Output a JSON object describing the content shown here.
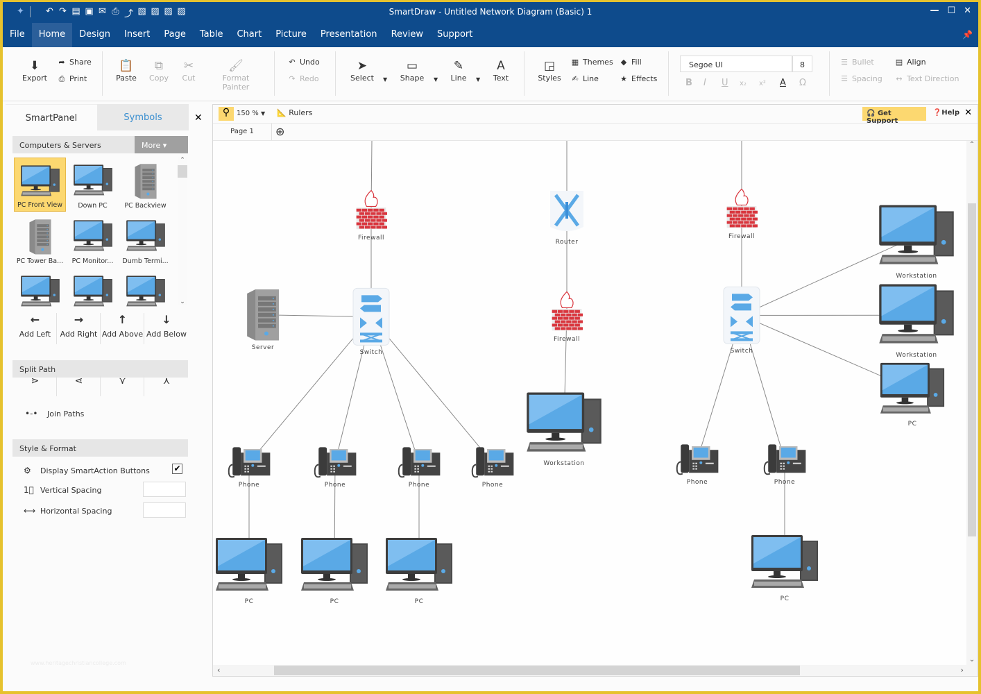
{
  "window": {
    "title": "SmartDraw - Untitled Network Diagram (Basic) 1",
    "controls": [
      "minimize-icon",
      "maximize-icon",
      "close-icon"
    ]
  },
  "quick_access": [
    "undo-icon",
    "redo-icon",
    "new-doc-icon",
    "save-icon",
    "email-icon",
    "print-icon",
    "share-icon",
    "pdf-icon",
    "word-icon",
    "powerpoint-icon",
    "excel-icon"
  ],
  "menu": {
    "items": [
      "File",
      "Home",
      "Design",
      "Insert",
      "Page",
      "Table",
      "Chart",
      "Picture",
      "Presentation",
      "Review",
      "Support"
    ],
    "active": "Home"
  },
  "ribbon": {
    "export": "Export",
    "share": "Share",
    "print": "Print",
    "paste": "Paste",
    "copy": "Copy",
    "cut": "Cut",
    "format_painter": "Format Painter",
    "undo": "Undo",
    "redo": "Redo",
    "select": "Select",
    "shape": "Shape",
    "line": "Line",
    "text": "Text",
    "styles": "Styles",
    "themes": "Themes",
    "fill": "Fill",
    "line_style": "Line",
    "effects": "Effects",
    "font_name": "Segoe UI",
    "font_size": "8",
    "format_buttons": [
      "B",
      "I",
      "U",
      "x₂",
      "x²",
      "A",
      "Ω"
    ],
    "bullet": "Bullet",
    "spacing": "Spacing",
    "align": "Align",
    "text_direction": "Text Direction"
  },
  "sidepanel": {
    "tabs": [
      "SmartPanel",
      "Symbols"
    ],
    "active_tab": "Symbols",
    "library": "Computers & Servers",
    "more": "More",
    "symbols": [
      {
        "label": "PC Front View",
        "selected": true
      },
      {
        "label": "Down PC"
      },
      {
        "label": "PC Backview"
      },
      {
        "label": "PC Tower Ba..."
      },
      {
        "label": "PC Monitor..."
      },
      {
        "label": "Dumb Termi..."
      },
      {
        "label": ""
      },
      {
        "label": ""
      },
      {
        "label": ""
      }
    ],
    "add_buttons": [
      "Add Left",
      "Add Right",
      "Add Above",
      "Add Below"
    ],
    "split_path_title": "Split Path",
    "join_paths": "Join Paths",
    "style_format_title": "Style & Format",
    "display_smartaction": "Display SmartAction Buttons",
    "display_smartaction_checked": true,
    "vertical_spacing": "Vertical Spacing",
    "vertical_spacing_value": "",
    "horizontal_spacing": "Horizontal Spacing",
    "horizontal_spacing_value": "",
    "watermark": "www.heritagechristiancollege.com"
  },
  "canvas": {
    "zoom": "150 %",
    "rulers": "Rulers",
    "get_support": "Get Support",
    "help": "Help",
    "page_tab": "Page 1"
  },
  "diagram": {
    "nodes": [
      {
        "id": "fw1",
        "type": "firewall",
        "label": "Firewall"
      },
      {
        "id": "router",
        "type": "router",
        "label": "Router"
      },
      {
        "id": "fw3",
        "type": "firewall",
        "label": "Firewall"
      },
      {
        "id": "server",
        "type": "server",
        "label": "Server"
      },
      {
        "id": "sw1",
        "type": "switch",
        "label": "Switch"
      },
      {
        "id": "fw2",
        "type": "firewall",
        "label": "Firewall"
      },
      {
        "id": "sw2",
        "type": "switch",
        "label": "Switch"
      },
      {
        "id": "ws1",
        "type": "pc",
        "label": "Workstation"
      },
      {
        "id": "ws2",
        "type": "pc",
        "label": "Workstation"
      },
      {
        "id": "pcR",
        "type": "pc",
        "label": "PC"
      },
      {
        "id": "wsMid",
        "type": "pc",
        "label": "Workstation"
      },
      {
        "id": "ph1",
        "type": "phone",
        "label": "Phone"
      },
      {
        "id": "ph2",
        "type": "phone",
        "label": "Phone"
      },
      {
        "id": "ph3",
        "type": "phone",
        "label": "Phone"
      },
      {
        "id": "ph4",
        "type": "phone",
        "label": "Phone"
      },
      {
        "id": "ph5",
        "type": "phone",
        "label": "Phone"
      },
      {
        "id": "ph6",
        "type": "phone",
        "label": "Phone"
      },
      {
        "id": "pc1",
        "type": "pc",
        "label": "PC"
      },
      {
        "id": "pc2",
        "type": "pc",
        "label": "PC"
      },
      {
        "id": "pc3",
        "type": "pc",
        "label": "PC"
      },
      {
        "id": "pc4",
        "type": "pc",
        "label": "PC"
      }
    ],
    "edges": [
      [
        "top1",
        "fw1"
      ],
      [
        "fw1",
        "sw1"
      ],
      [
        "server",
        "sw1"
      ],
      [
        "sw1",
        "ph1"
      ],
      [
        "sw1",
        "ph2"
      ],
      [
        "sw1",
        "ph3"
      ],
      [
        "sw1",
        "ph4"
      ],
      [
        "ph1",
        "pc1"
      ],
      [
        "ph2",
        "pc2"
      ],
      [
        "ph3",
        "pc3"
      ],
      [
        "top2",
        "router"
      ],
      [
        "router",
        "fw2"
      ],
      [
        "fw2",
        "wsMid"
      ],
      [
        "top3",
        "fw3"
      ],
      [
        "fw3",
        "sw2"
      ],
      [
        "sw2",
        "ws1"
      ],
      [
        "sw2",
        "ws2"
      ],
      [
        "sw2",
        "pcR"
      ],
      [
        "sw2",
        "ph5"
      ],
      [
        "sw2",
        "ph6"
      ],
      [
        "ph6",
        "pc4"
      ]
    ]
  },
  "colors": {
    "titlebar": "#0e4b8c",
    "accent_yellow": "#fcd870",
    "symbols_tab_text": "#3a8fd0",
    "firewall_red": "#d9363e",
    "device_blue": "#5aa9e6"
  }
}
